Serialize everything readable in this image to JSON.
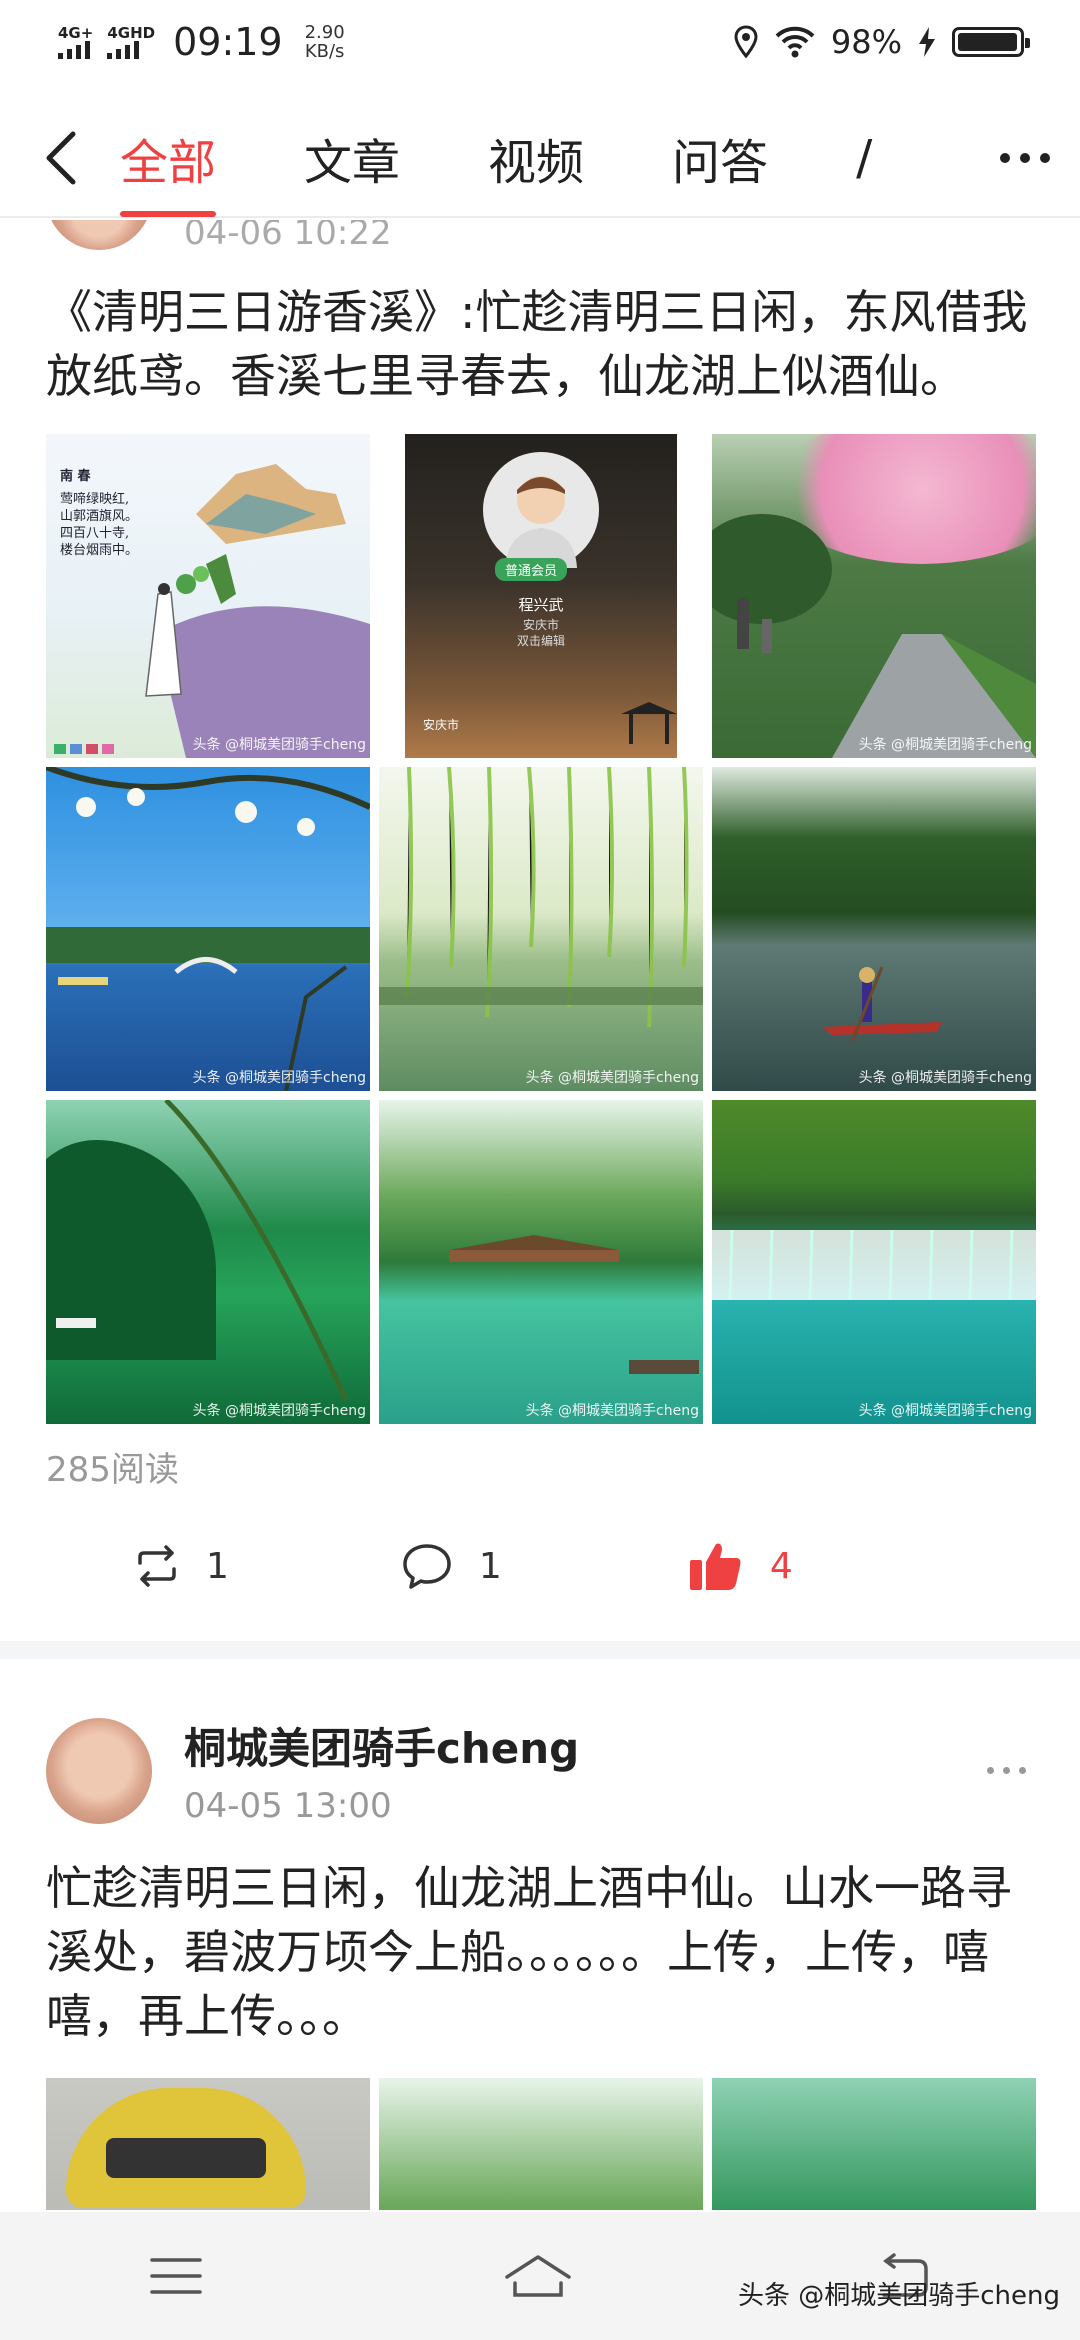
{
  "status_bar": {
    "net1": "4G+",
    "net2": "4GHD",
    "time": "09:19",
    "speed_value": "2.90",
    "speed_unit": "KB/s",
    "battery": "98%",
    "battery_level": 0.98
  },
  "nav": {
    "tabs": [
      {
        "label": "全部",
        "active": true
      },
      {
        "label": "文章",
        "active": false
      },
      {
        "label": "视频",
        "active": false
      },
      {
        "label": "问答",
        "active": false
      },
      {
        "label": "/",
        "active": false
      }
    ]
  },
  "post1": {
    "time": "04-06 10:22",
    "text": "《清明三日游香溪》:忙趁清明三日闲，东风借我放纸鸢。香溪七里寻春去，仙龙湖上似酒仙。",
    "image_card": {
      "badge": "普通会员",
      "name": "程兴武",
      "city": "安庆市",
      "hint": "双击编辑",
      "location": "安庆市"
    },
    "poem": {
      "title": "南 春",
      "lines": [
        "莺啼绿映红,",
        "山郭酒旗风。",
        "四百八十寺,",
        "楼台烟雨中。"
      ]
    },
    "watermark": "头条 @桐城美团骑手cheng",
    "read_count": "285阅读",
    "repost_count": "1",
    "comment_count": "1",
    "like_count": "4"
  },
  "post2": {
    "author": "桐城美团骑手cheng",
    "time": "04-05 13:00",
    "text": "忙趁清明三日闲，仙龙湖上酒中仙。山水一路寻溪处，碧波万顷今上船。。。。。。上传，上传，嘻嘻，再上传。。。"
  },
  "footer": {
    "watermark": "头条 @桐城美团骑手cheng"
  },
  "colors": {
    "accent": "#f04142",
    "text": "#222222",
    "muted": "#999999"
  }
}
